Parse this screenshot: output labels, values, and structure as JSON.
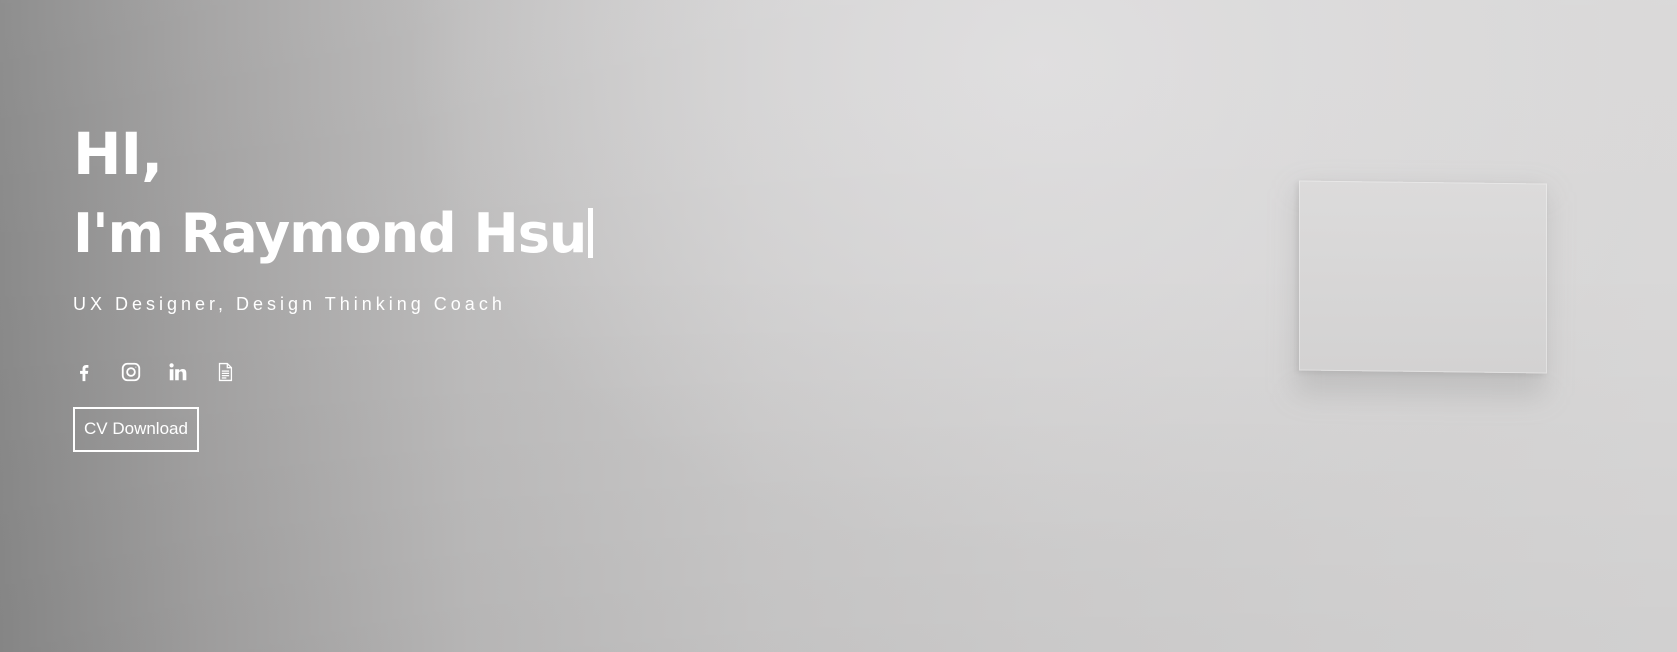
{
  "hero": {
    "greeting": "HI,",
    "name_line": "I'm Raymond Hsu",
    "tagline": "UX Designer, Design Thinking Coach",
    "cv_button_label": "CV Download"
  },
  "social": [
    {
      "icon": "facebook-icon"
    },
    {
      "icon": "instagram-icon"
    },
    {
      "icon": "linkedin-icon"
    },
    {
      "icon": "document-icon"
    }
  ],
  "colors": {
    "text": "#ffffff",
    "background_left": "#8a8a8a",
    "background_right": "#d9d8d8"
  }
}
